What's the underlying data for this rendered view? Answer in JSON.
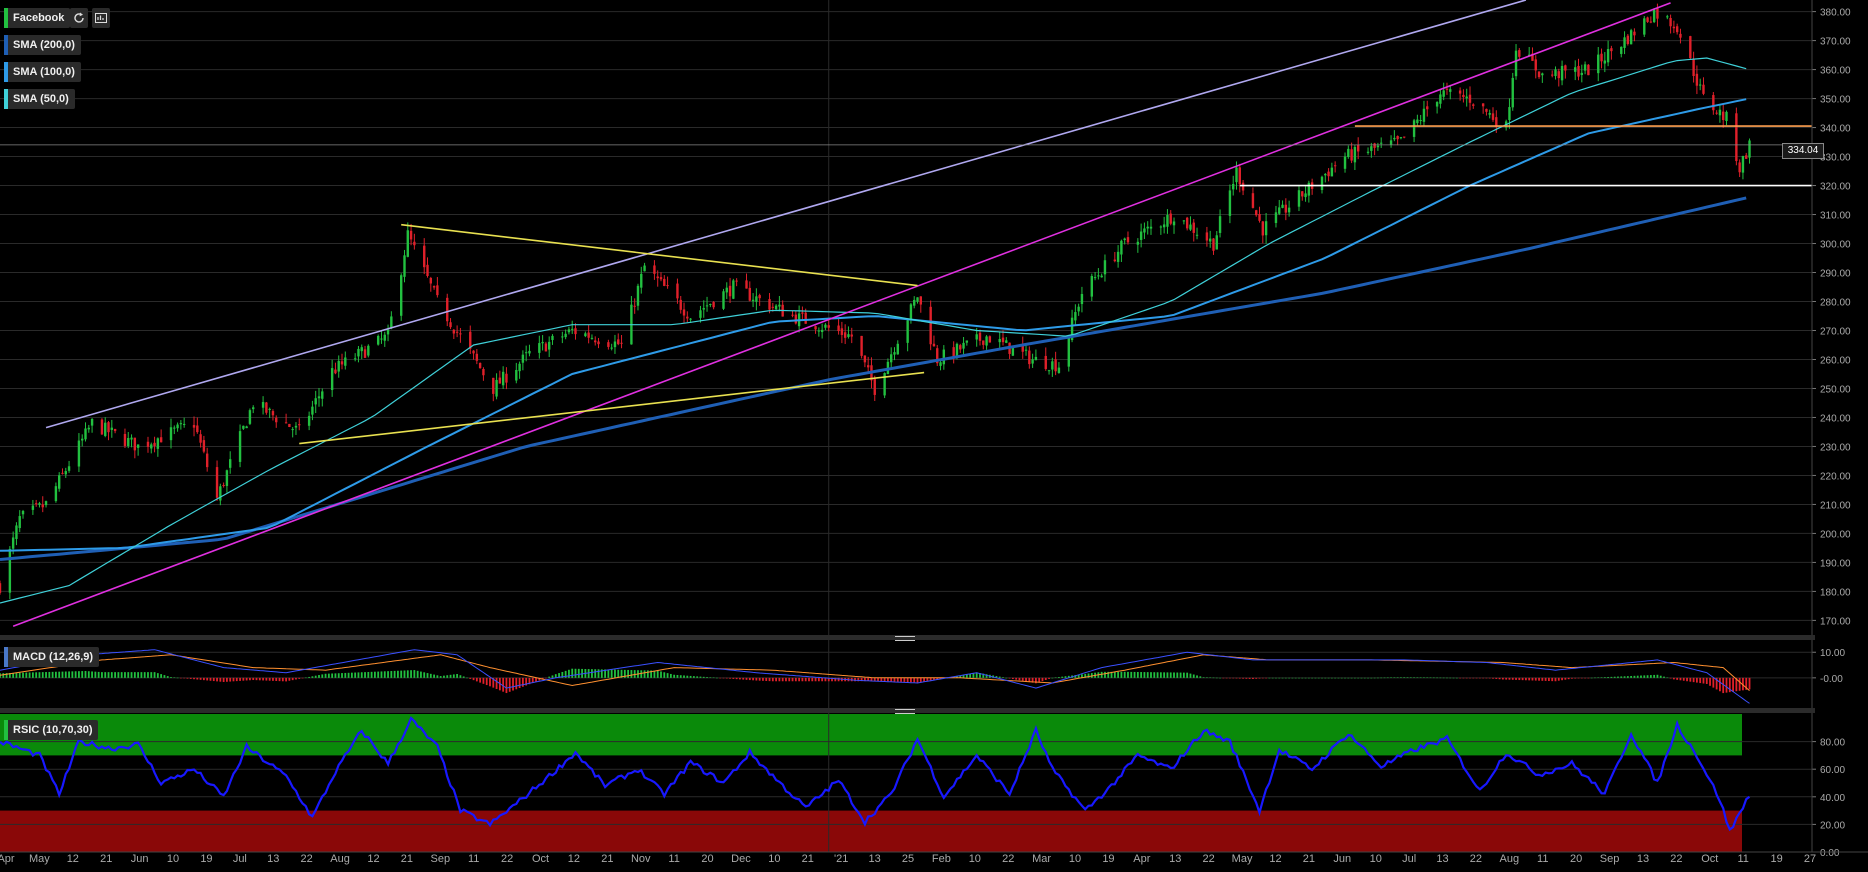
{
  "chart_data": [
    {
      "type": "candlestick",
      "title": "Facebook",
      "ylim": [
        166,
        384
      ],
      "x_axis": {
        "start": "2020-04-24",
        "end": "2021-10-27",
        "tick_labels": [
          "Apr",
          "May",
          "12",
          "21",
          "Jun",
          "10",
          "19",
          "Jul",
          "13",
          "22",
          "Aug",
          "12",
          "21",
          "Sep",
          "11",
          "22",
          "Oct",
          "12",
          "21",
          "Nov",
          "11",
          "20",
          "Dec",
          "10",
          "21",
          "'21",
          "13",
          "25",
          "Feb",
          "10",
          "22",
          "Mar",
          "10",
          "19",
          "Apr",
          "13",
          "22",
          "May",
          "12",
          "21",
          "Jun",
          "10",
          "Jul",
          "13",
          "22",
          "Aug",
          "11",
          "20",
          "Sep",
          "13",
          "22",
          "Oct",
          "11",
          "19",
          "27"
        ]
      },
      "y_axis": {
        "ticks": [
          "170.00",
          "180.00",
          "190.00",
          "200.00",
          "210.00",
          "220.00",
          "230.00",
          "240.00",
          "250.00",
          "260.00",
          "270.00",
          "280.00",
          "290.00",
          "300.00",
          "310.00",
          "320.00",
          "330.00",
          "340.00",
          "350.00",
          "360.00",
          "370.00",
          "380.00"
        ]
      },
      "grid": true,
      "last_price": "334.04",
      "price_anchors": [
        [
          "2020-04-24",
          182
        ],
        [
          "2020-04-30",
          205
        ],
        [
          "2020-05-08",
          210
        ],
        [
          "2020-05-22",
          238
        ],
        [
          "2020-06-05",
          230
        ],
        [
          "2020-06-22",
          238
        ],
        [
          "2020-06-29",
          212
        ],
        [
          "2020-07-10",
          245
        ],
        [
          "2020-07-24",
          235
        ],
        [
          "2020-08-03",
          256
        ],
        [
          "2020-08-20",
          268
        ],
        [
          "2020-08-26",
          303
        ],
        [
          "2020-09-04",
          280
        ],
        [
          "2020-09-21",
          250
        ],
        [
          "2020-10-02",
          262
        ],
        [
          "2020-10-15",
          270
        ],
        [
          "2020-10-30",
          265
        ],
        [
          "2020-11-06",
          292
        ],
        [
          "2020-11-20",
          275
        ],
        [
          "2020-12-03",
          285
        ],
        [
          "2020-12-21",
          275
        ],
        [
          "2021-01-08",
          268
        ],
        [
          "2021-01-15",
          250
        ],
        [
          "2021-01-28",
          282
        ],
        [
          "2021-02-03",
          260
        ],
        [
          "2021-02-18",
          268
        ],
        [
          "2021-03-04",
          260
        ],
        [
          "2021-03-12",
          258
        ],
        [
          "2021-03-19",
          283
        ],
        [
          "2021-04-01",
          300
        ],
        [
          "2021-04-16",
          310
        ],
        [
          "2021-04-28",
          300
        ],
        [
          "2021-05-05",
          325
        ],
        [
          "2021-05-13",
          305
        ],
        [
          "2021-05-26",
          318
        ],
        [
          "2021-06-07",
          330
        ],
        [
          "2021-06-24",
          335
        ],
        [
          "2021-07-06",
          352
        ],
        [
          "2021-07-15",
          350
        ],
        [
          "2021-07-26",
          340
        ],
        [
          "2021-07-29",
          368
        ],
        [
          "2021-08-06",
          358
        ],
        [
          "2021-08-20",
          360
        ],
        [
          "2021-09-02",
          372
        ],
        [
          "2021-09-09",
          380
        ],
        [
          "2021-09-16",
          375
        ],
        [
          "2021-09-24",
          350
        ],
        [
          "2021-10-01",
          343
        ],
        [
          "2021-10-05",
          326
        ],
        [
          "2021-10-08",
          334
        ]
      ],
      "moving_averages": [
        {
          "name": "SMA (200,0)",
          "color": "#1f5fb5",
          "points": [
            [
              "2020-04-24",
              191
            ],
            [
              "2020-07-01",
              198
            ],
            [
              "2020-10-01",
              230
            ],
            [
              "2021-01-01",
              253
            ],
            [
              "2021-03-01",
              265
            ],
            [
              "2021-06-01",
              283
            ],
            [
              "2021-08-01",
              298
            ],
            [
              "2021-10-08",
              316
            ]
          ]
        },
        {
          "name": "SMA (100,0)",
          "color": "#2e9be8",
          "points": [
            [
              "2020-04-24",
              194
            ],
            [
              "2020-06-01",
              195
            ],
            [
              "2020-07-15",
              202
            ],
            [
              "2020-09-01",
              230
            ],
            [
              "2020-10-15",
              255
            ],
            [
              "2020-12-15",
              273
            ],
            [
              "2021-01-15",
              275
            ],
            [
              "2021-03-01",
              270
            ],
            [
              "2021-04-15",
              275
            ],
            [
              "2021-06-01",
              295
            ],
            [
              "2021-07-15",
              320
            ],
            [
              "2021-08-20",
              338
            ],
            [
              "2021-09-25",
              347
            ],
            [
              "2021-10-08",
              350
            ]
          ]
        },
        {
          "name": "SMA (50,0)",
          "color": "#3fd0d8",
          "points": [
            [
              "2020-04-24",
              176
            ],
            [
              "2020-05-15",
              182
            ],
            [
              "2020-06-15",
              203
            ],
            [
              "2020-07-15",
              222
            ],
            [
              "2020-08-15",
              240
            ],
            [
              "2020-09-15",
              265
            ],
            [
              "2020-10-15",
              272
            ],
            [
              "2020-11-15",
              272
            ],
            [
              "2020-12-15",
              277
            ],
            [
              "2021-01-15",
              276
            ],
            [
              "2021-02-15",
              270
            ],
            [
              "2021-03-15",
              268
            ],
            [
              "2021-04-15",
              280
            ],
            [
              "2021-05-15",
              300
            ],
            [
              "2021-06-15",
              318
            ],
            [
              "2021-07-15",
              335
            ],
            [
              "2021-08-15",
              352
            ],
            [
              "2021-09-15",
              363
            ],
            [
              "2021-09-25",
              364
            ],
            [
              "2021-10-08",
              360
            ]
          ]
        }
      ],
      "drawings": [
        {
          "color": "#b0a8f0",
          "from": [
            "2020-05-08",
            236.5
          ],
          "to": [
            "2021-08-01",
            384
          ]
        },
        {
          "color": "#e030e0",
          "from": [
            "2020-04-28",
            168
          ],
          "to": [
            "2021-09-14",
            383
          ]
        },
        {
          "color": "#e8e050",
          "from": [
            "2020-08-24",
            306.5
          ],
          "to": [
            "2021-01-28",
            285.5
          ]
        },
        {
          "color": "#e8e050",
          "from": [
            "2020-07-24",
            231
          ],
          "to": [
            "2021-01-30",
            255.5
          ]
        },
        {
          "color": "#ffa050",
          "from": [
            "2021-06-10",
            340.5
          ],
          "to": [
            "2021-10-27",
            340.5
          ]
        },
        {
          "color": "#ffffff",
          "from": [
            "2021-05-06",
            320
          ],
          "to": [
            "2021-10-27",
            320
          ]
        }
      ]
    },
    {
      "type": "line",
      "title": "MACD (12,26,9)",
      "ylim": [
        -11,
        14
      ],
      "y_axis": {
        "ticks": [
          "10.00",
          "-0.00"
        ]
      },
      "series": [
        {
          "name": "macd",
          "color": "#3a50ff",
          "points": [
            [
              "2020-04-24",
              3
            ],
            [
              "2020-05-20",
              9
            ],
            [
              "2020-06-10",
              11
            ],
            [
              "2020-07-01",
              4
            ],
            [
              "2020-07-20",
              2
            ],
            [
              "2020-08-28",
              11
            ],
            [
              "2020-09-10",
              9
            ],
            [
              "2020-09-25",
              -4
            ],
            [
              "2020-10-10",
              0
            ],
            [
              "2020-11-10",
              6
            ],
            [
              "2020-12-10",
              2
            ],
            [
              "2021-01-10",
              -1
            ],
            [
              "2021-01-28",
              -2
            ],
            [
              "2021-02-15",
              2
            ],
            [
              "2021-03-05",
              -4
            ],
            [
              "2021-03-25",
              4
            ],
            [
              "2021-04-20",
              10
            ],
            [
              "2021-05-10",
              7
            ],
            [
              "2021-06-05",
              7
            ],
            [
              "2021-06-25",
              7
            ],
            [
              "2021-07-20",
              6
            ],
            [
              "2021-08-10",
              3
            ],
            [
              "2021-09-10",
              7
            ],
            [
              "2021-09-25",
              2
            ],
            [
              "2021-10-08",
              -10
            ]
          ]
        },
        {
          "name": "signal",
          "color": "#ff9030",
          "points": [
            [
              "2020-04-24",
              1
            ],
            [
              "2020-05-25",
              7
            ],
            [
              "2020-06-15",
              9
            ],
            [
              "2020-07-10",
              4
            ],
            [
              "2020-08-01",
              3
            ],
            [
              "2020-09-05",
              9
            ],
            [
              "2020-09-20",
              4
            ],
            [
              "2020-10-15",
              -3
            ],
            [
              "2020-11-15",
              4
            ],
            [
              "2020-12-15",
              3
            ],
            [
              "2021-01-15",
              0
            ],
            [
              "2021-02-10",
              0
            ],
            [
              "2021-03-10",
              -2
            ],
            [
              "2021-04-01",
              3
            ],
            [
              "2021-04-25",
              9
            ],
            [
              "2021-05-15",
              7
            ],
            [
              "2021-06-15",
              7
            ],
            [
              "2021-07-25",
              6
            ],
            [
              "2021-08-15",
              4
            ],
            [
              "2021-09-15",
              6
            ],
            [
              "2021-09-30",
              4
            ],
            [
              "2021-10-08",
              -5
            ]
          ]
        }
      ]
    },
    {
      "type": "line",
      "title": "RSIC (10,70,30)",
      "ylim": [
        0,
        100
      ],
      "y_axis": {
        "ticks": [
          "0.00",
          "20.00",
          "40.00",
          "60.00",
          "80.00"
        ]
      },
      "overbought": 70,
      "oversold": 30,
      "series": [
        {
          "name": "RSI",
          "color": "#1818ff",
          "points": [
            [
              "2020-04-24",
              80
            ],
            [
              "2020-05-06",
              70
            ],
            [
              "2020-05-12",
              42
            ],
            [
              "2020-05-18",
              80
            ],
            [
              "2020-05-28",
              75
            ],
            [
              "2020-06-05",
              78
            ],
            [
              "2020-06-12",
              50
            ],
            [
              "2020-06-22",
              60
            ],
            [
              "2020-07-01",
              40
            ],
            [
              "2020-07-08",
              76
            ],
            [
              "2020-07-20",
              55
            ],
            [
              "2020-07-28",
              25
            ],
            [
              "2020-08-04",
              58
            ],
            [
              "2020-08-12",
              88
            ],
            [
              "2020-08-20",
              64
            ],
            [
              "2020-08-27",
              96
            ],
            [
              "2020-09-04",
              76
            ],
            [
              "2020-09-11",
              30
            ],
            [
              "2020-09-20",
              20
            ],
            [
              "2020-09-28",
              35
            ],
            [
              "2020-10-08",
              55
            ],
            [
              "2020-10-16",
              72
            ],
            [
              "2020-10-25",
              48
            ],
            [
              "2020-11-04",
              60
            ],
            [
              "2020-11-12",
              42
            ],
            [
              "2020-11-20",
              65
            ],
            [
              "2020-11-30",
              50
            ],
            [
              "2020-12-08",
              72
            ],
            [
              "2020-12-18",
              48
            ],
            [
              "2020-12-25",
              32
            ],
            [
              "2021-01-04",
              52
            ],
            [
              "2021-01-12",
              22
            ],
            [
              "2021-01-20",
              42
            ],
            [
              "2021-01-28",
              82
            ],
            [
              "2021-02-05",
              40
            ],
            [
              "2021-02-15",
              70
            ],
            [
              "2021-02-25",
              42
            ],
            [
              "2021-03-05",
              88
            ],
            [
              "2021-03-10",
              60
            ],
            [
              "2021-03-20",
              30
            ],
            [
              "2021-03-28",
              48
            ],
            [
              "2021-04-05",
              70
            ],
            [
              "2021-04-15",
              60
            ],
            [
              "2021-04-25",
              88
            ],
            [
              "2021-05-03",
              80
            ],
            [
              "2021-05-12",
              30
            ],
            [
              "2021-05-18",
              74
            ],
            [
              "2021-05-28",
              60
            ],
            [
              "2021-06-08",
              86
            ],
            [
              "2021-06-18",
              62
            ],
            [
              "2021-06-28",
              74
            ],
            [
              "2021-07-08",
              82
            ],
            [
              "2021-07-18",
              44
            ],
            [
              "2021-07-26",
              72
            ],
            [
              "2021-08-05",
              56
            ],
            [
              "2021-08-15",
              64
            ],
            [
              "2021-08-25",
              42
            ],
            [
              "2021-09-02",
              86
            ],
            [
              "2021-09-10",
              50
            ],
            [
              "2021-09-16",
              92
            ],
            [
              "2021-09-22",
              70
            ],
            [
              "2021-09-29",
              38
            ],
            [
              "2021-10-02",
              15
            ],
            [
              "2021-10-05",
              28
            ],
            [
              "2021-10-08",
              42
            ]
          ]
        }
      ]
    }
  ],
  "tags": [
    {
      "label": "Facebook",
      "color": "#22c040"
    },
    {
      "label": "SMA (200,0)",
      "color": "#1f5fb5"
    },
    {
      "label": "SMA (100,0)",
      "color": "#2e9be8"
    },
    {
      "label": "SMA (50,0)",
      "color": "#3fd0d8"
    },
    {
      "label": "MACD (12,26,9)",
      "color": "#4a78c8"
    },
    {
      "label": "RSIC (10,70,30)",
      "color": "#22c040"
    }
  ],
  "icons": {
    "refresh": "refresh-icon",
    "settings": "chart-settings-icon",
    "grip": "grip-icon"
  },
  "colors": {
    "up": "#22c040",
    "down": "#e0202a",
    "overbought_zone": "#0a8a0a",
    "oversold_zone": "#8a0808"
  }
}
